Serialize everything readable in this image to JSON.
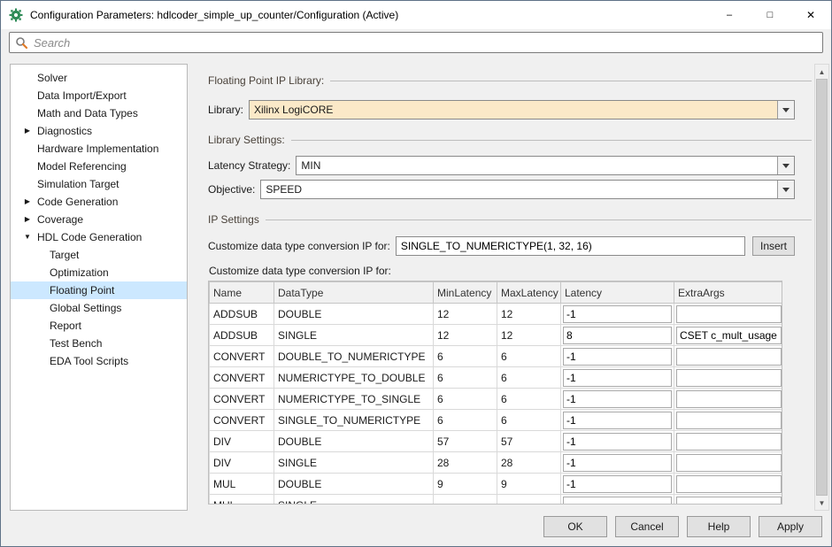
{
  "window": {
    "title": "Configuration Parameters: hdlcoder_simple_up_counter/Configuration (Active)",
    "controls": {
      "minimize": "–",
      "maximize": "□",
      "close": "✕"
    }
  },
  "search": {
    "placeholder": "Search"
  },
  "colors": {
    "selection_blue": "#cce8ff",
    "field_highlight_tan": "#fbe9c8",
    "section_header_text": "#4a423a"
  },
  "sidebar": {
    "icons": {
      "collapsed": "▶",
      "expanded": "▼"
    },
    "items": [
      {
        "label": "Solver",
        "level": 0,
        "arrow": ""
      },
      {
        "label": "Data Import/Export",
        "level": 0,
        "arrow": ""
      },
      {
        "label": "Math and Data Types",
        "level": 0,
        "arrow": ""
      },
      {
        "label": "Diagnostics",
        "level": 0,
        "arrow": "collapsed"
      },
      {
        "label": "Hardware Implementation",
        "level": 0,
        "arrow": ""
      },
      {
        "label": "Model Referencing",
        "level": 0,
        "arrow": ""
      },
      {
        "label": "Simulation Target",
        "level": 0,
        "arrow": ""
      },
      {
        "label": "Code Generation",
        "level": 0,
        "arrow": "collapsed"
      },
      {
        "label": "Coverage",
        "level": 0,
        "arrow": "collapsed"
      },
      {
        "label": "HDL Code Generation",
        "level": 0,
        "arrow": "expanded"
      },
      {
        "label": "Target",
        "level": 1,
        "arrow": ""
      },
      {
        "label": "Optimization",
        "level": 1,
        "arrow": ""
      },
      {
        "label": "Floating Point",
        "level": 1,
        "arrow": "",
        "selected": true
      },
      {
        "label": "Global Settings",
        "level": 1,
        "arrow": ""
      },
      {
        "label": "Report",
        "level": 1,
        "arrow": ""
      },
      {
        "label": "Test Bench",
        "level": 1,
        "arrow": ""
      },
      {
        "label": "EDA Tool Scripts",
        "level": 1,
        "arrow": ""
      }
    ]
  },
  "main": {
    "sections": {
      "ip_library": "Floating Point IP Library:",
      "library_settings": "Library Settings:",
      "ip_settings": "IP Settings"
    },
    "fields": {
      "library": {
        "label": "Library:",
        "value": "Xilinx LogiCORE"
      },
      "latency_strategy": {
        "label": "Latency Strategy:",
        "value": "MIN"
      },
      "objective": {
        "label": "Objective:",
        "value": "SPEED"
      },
      "customize_input": {
        "label": "Customize data type conversion IP for:",
        "value": "SINGLE_TO_NUMERICTYPE(1, 32, 16)",
        "button": "Insert"
      }
    },
    "table": {
      "caption": "Customize data type conversion IP for:",
      "columns": [
        "Name",
        "DataType",
        "MinLatency",
        "MaxLatency",
        "Latency",
        "ExtraArgs"
      ],
      "rows": [
        {
          "name": "ADDSUB",
          "datatype": "DOUBLE",
          "min": "12",
          "max": "12",
          "latency": "-1",
          "extra": ""
        },
        {
          "name": "ADDSUB",
          "datatype": "SINGLE",
          "min": "12",
          "max": "12",
          "latency": "8",
          "extra": "CSET c_mult_usage"
        },
        {
          "name": "CONVERT",
          "datatype": "DOUBLE_TO_NUMERICTYPE",
          "min": "6",
          "max": "6",
          "latency": "-1",
          "extra": ""
        },
        {
          "name": "CONVERT",
          "datatype": "NUMERICTYPE_TO_DOUBLE",
          "min": "6",
          "max": "6",
          "latency": "-1",
          "extra": ""
        },
        {
          "name": "CONVERT",
          "datatype": "NUMERICTYPE_TO_SINGLE",
          "min": "6",
          "max": "6",
          "latency": "-1",
          "extra": ""
        },
        {
          "name": "CONVERT",
          "datatype": "SINGLE_TO_NUMERICTYPE",
          "min": "6",
          "max": "6",
          "latency": "-1",
          "extra": ""
        },
        {
          "name": "DIV",
          "datatype": "DOUBLE",
          "min": "57",
          "max": "57",
          "latency": "-1",
          "extra": ""
        },
        {
          "name": "DIV",
          "datatype": "SINGLE",
          "min": "28",
          "max": "28",
          "latency": "-1",
          "extra": ""
        },
        {
          "name": "MUL",
          "datatype": "DOUBLE",
          "min": "9",
          "max": "9",
          "latency": "-1",
          "extra": ""
        },
        {
          "name": "MUL",
          "datatype": "SINGLE",
          "min": "",
          "max": "",
          "latency": "",
          "extra": ""
        }
      ]
    }
  },
  "footer": {
    "buttons": [
      "OK",
      "Cancel",
      "Help",
      "Apply"
    ]
  }
}
